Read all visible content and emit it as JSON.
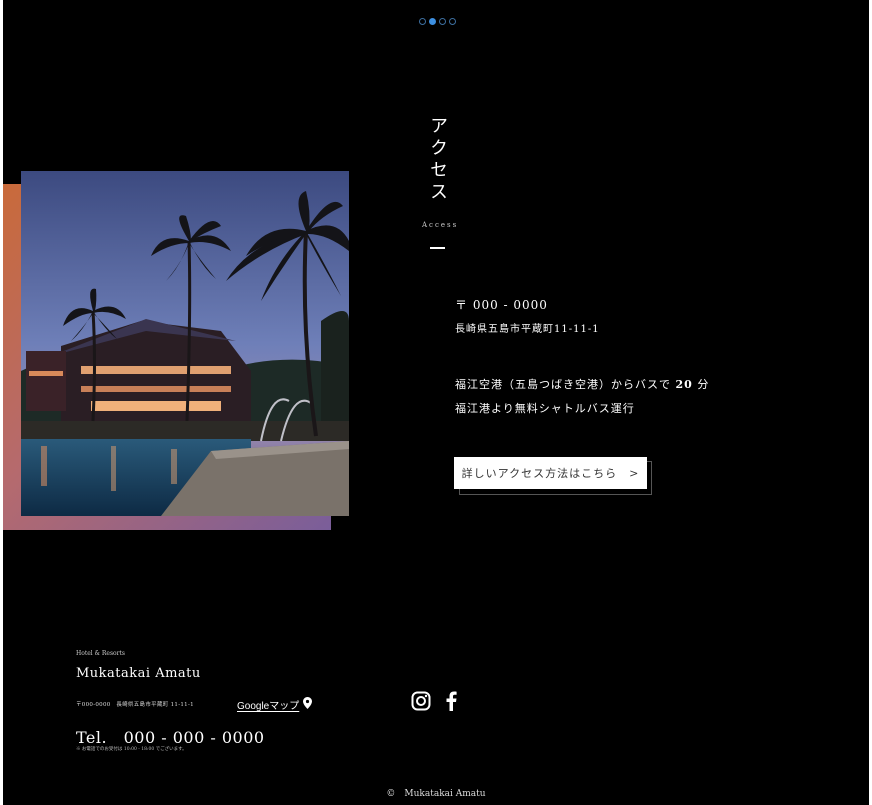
{
  "pager": {
    "count": 4,
    "active_index": 1,
    "active_color": "#3d8fe0"
  },
  "section": {
    "title_ja": "アクセス",
    "title_en": "Access"
  },
  "access": {
    "postal": "〒 000 - 0000",
    "address": "長崎県五島市平蔵町11-11-1",
    "route_prefix": "福江空港（五島つばき空港）からバスで",
    "route_minutes": "20",
    "route_suffix": "分",
    "shuttle": "福江港より無料シャトルバス運行",
    "detail_button_label": "詳しいアクセス方法はこちら",
    "detail_button_arrow": ">"
  },
  "footer": {
    "brand_small": "Hotel & Resorts",
    "hotel_name": "Mukatakai Amatu",
    "address": "〒000-0000　長崎県五島市平蔵町 11-11-1",
    "map_label": "Googleマップ",
    "map_icon": "map-pin-icon",
    "tel": "Tel.　000 - 000 - 0000",
    "tel_note": "※ お電話でのお受付は 10:00 - 18:00 でございます。",
    "social_icons": [
      "instagram-icon",
      "facebook-icon"
    ],
    "copyright": "©　Mukatakai Amatu"
  },
  "colors": {
    "background": "#000000",
    "gradient": [
      "#c96a3a",
      "#b56a6e",
      "#7a5e9a"
    ]
  }
}
